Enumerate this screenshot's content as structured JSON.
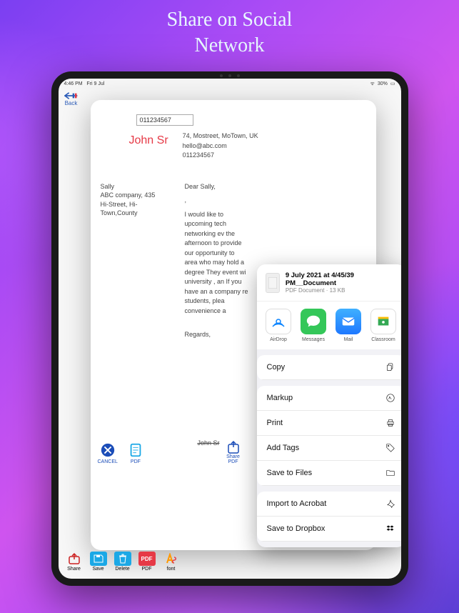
{
  "promo": {
    "title_l1": "Share on Social",
    "title_l2": "Network"
  },
  "status": {
    "time": "4:46 PM",
    "date": "Fri 9 Jul",
    "battery": "30%"
  },
  "nav": {
    "back": "Back"
  },
  "document": {
    "header_value": "011234567",
    "sender_name": "John Sr",
    "sender_address": "74, Mostreet, MoTown, UK",
    "sender_email": "hello@abc.com",
    "sender_phone": "011234567",
    "recipient_name": "Sally",
    "recipient_company": "ABC company, 435",
    "recipient_addr1": "Hi-Street, Hi-",
    "recipient_addr2": "Town,County",
    "greeting": "Dear Sally,",
    "body": "I would like to upcoming tech networking ev the afternoon to provide our opportunity to area who may hold a degree They event wi university , an If you have an a company re students, plea convenience a",
    "regards": "Regards,",
    "signature": "John Sr"
  },
  "doc_buttons": {
    "cancel": "CANCEL",
    "pdf": "PDF",
    "share": "Share",
    "share_sub": "PDF"
  },
  "toolbar": {
    "share": "Share",
    "save": "Save",
    "delete": "Delete",
    "pdf": "PDF",
    "font": "font"
  },
  "share_sheet": {
    "title": "9 July 2021 at 4/45/39 PM__Document",
    "subtitle": "PDF Document · 13 KB",
    "apps": [
      {
        "name": "AirDrop",
        "color": "#ffffff",
        "icon": "airdrop"
      },
      {
        "name": "Messages",
        "color": "#34c759",
        "icon": "messages"
      },
      {
        "name": "Mail",
        "color": "#1e90ff",
        "icon": "mail"
      },
      {
        "name": "Classroom",
        "color": "#fbbc04",
        "icon": "classroom"
      }
    ],
    "actions": [
      {
        "label": "Copy",
        "icon": "copy"
      },
      {
        "label": "Markup",
        "icon": "markup"
      },
      {
        "label": "Print",
        "icon": "print"
      },
      {
        "label": "Add Tags",
        "icon": "tag"
      },
      {
        "label": "Save to Files",
        "icon": "folder"
      },
      {
        "label": "Import to Acrobat",
        "icon": "acrobat"
      },
      {
        "label": "Save to Dropbox",
        "icon": "dropbox"
      }
    ]
  }
}
